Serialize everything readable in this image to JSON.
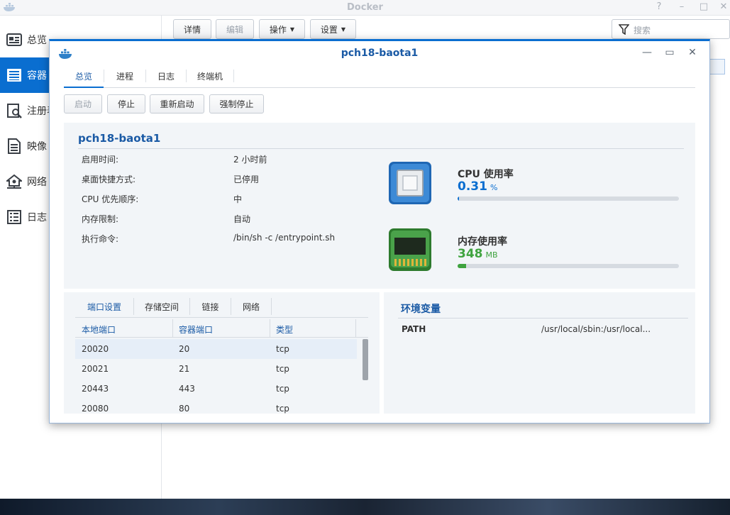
{
  "window": {
    "title": "Docker",
    "controls": [
      "?",
      "–",
      "□",
      "✕"
    ]
  },
  "sidebar": {
    "items": [
      {
        "label": "总览",
        "icon": "overview-icon"
      },
      {
        "label": "容器",
        "icon": "container-icon"
      },
      {
        "label": "注册表",
        "icon": "registry-icon"
      },
      {
        "label": "映像",
        "icon": "image-icon"
      },
      {
        "label": "网络",
        "icon": "network-icon"
      },
      {
        "label": "日志",
        "icon": "log-icon"
      }
    ]
  },
  "toolbar": {
    "details": "详情",
    "edit": "编辑",
    "action": "操作",
    "settings": "设置",
    "search_placeholder": "搜索"
  },
  "dialog": {
    "title": "pch18-baota1",
    "tabs": [
      "总览",
      "进程",
      "日志",
      "终端机"
    ],
    "buttons": [
      "启动",
      "停止",
      "重新启动",
      "强制停止"
    ],
    "container_name": "pch18-baota1",
    "info": [
      {
        "label": "启用时间:",
        "value": "2 小时前"
      },
      {
        "label": "桌面快捷方式:",
        "value": "已停用"
      },
      {
        "label": "CPU 优先顺序:",
        "value": "中"
      },
      {
        "label": "内存限制:",
        "value": "自动"
      },
      {
        "label": "执行命令:",
        "value": "/bin/sh -c /entrypoint.sh"
      }
    ],
    "cpu": {
      "title": "CPU 使用率",
      "value": "0.31",
      "unit": "%",
      "usage_fraction": 0.003,
      "color": "#0a6ed0"
    },
    "memory": {
      "title": "内存使用率",
      "value": "348",
      "unit": "MB",
      "usage_fraction": 0.04,
      "color": "#3fa33f"
    },
    "ports": {
      "tabs": [
        "端口设置",
        "存储空间",
        "链接",
        "网络"
      ],
      "columns": [
        "本地端口",
        "容器端口",
        "类型"
      ],
      "rows": [
        [
          "20020",
          "20",
          "tcp"
        ],
        [
          "20021",
          "21",
          "tcp"
        ],
        [
          "20443",
          "443",
          "tcp"
        ],
        [
          "20080",
          "80",
          "tcp"
        ]
      ]
    },
    "env": {
      "title": "环境变量",
      "key": "PATH",
      "value": "/usr/local/sbin:/usr/local..."
    }
  }
}
